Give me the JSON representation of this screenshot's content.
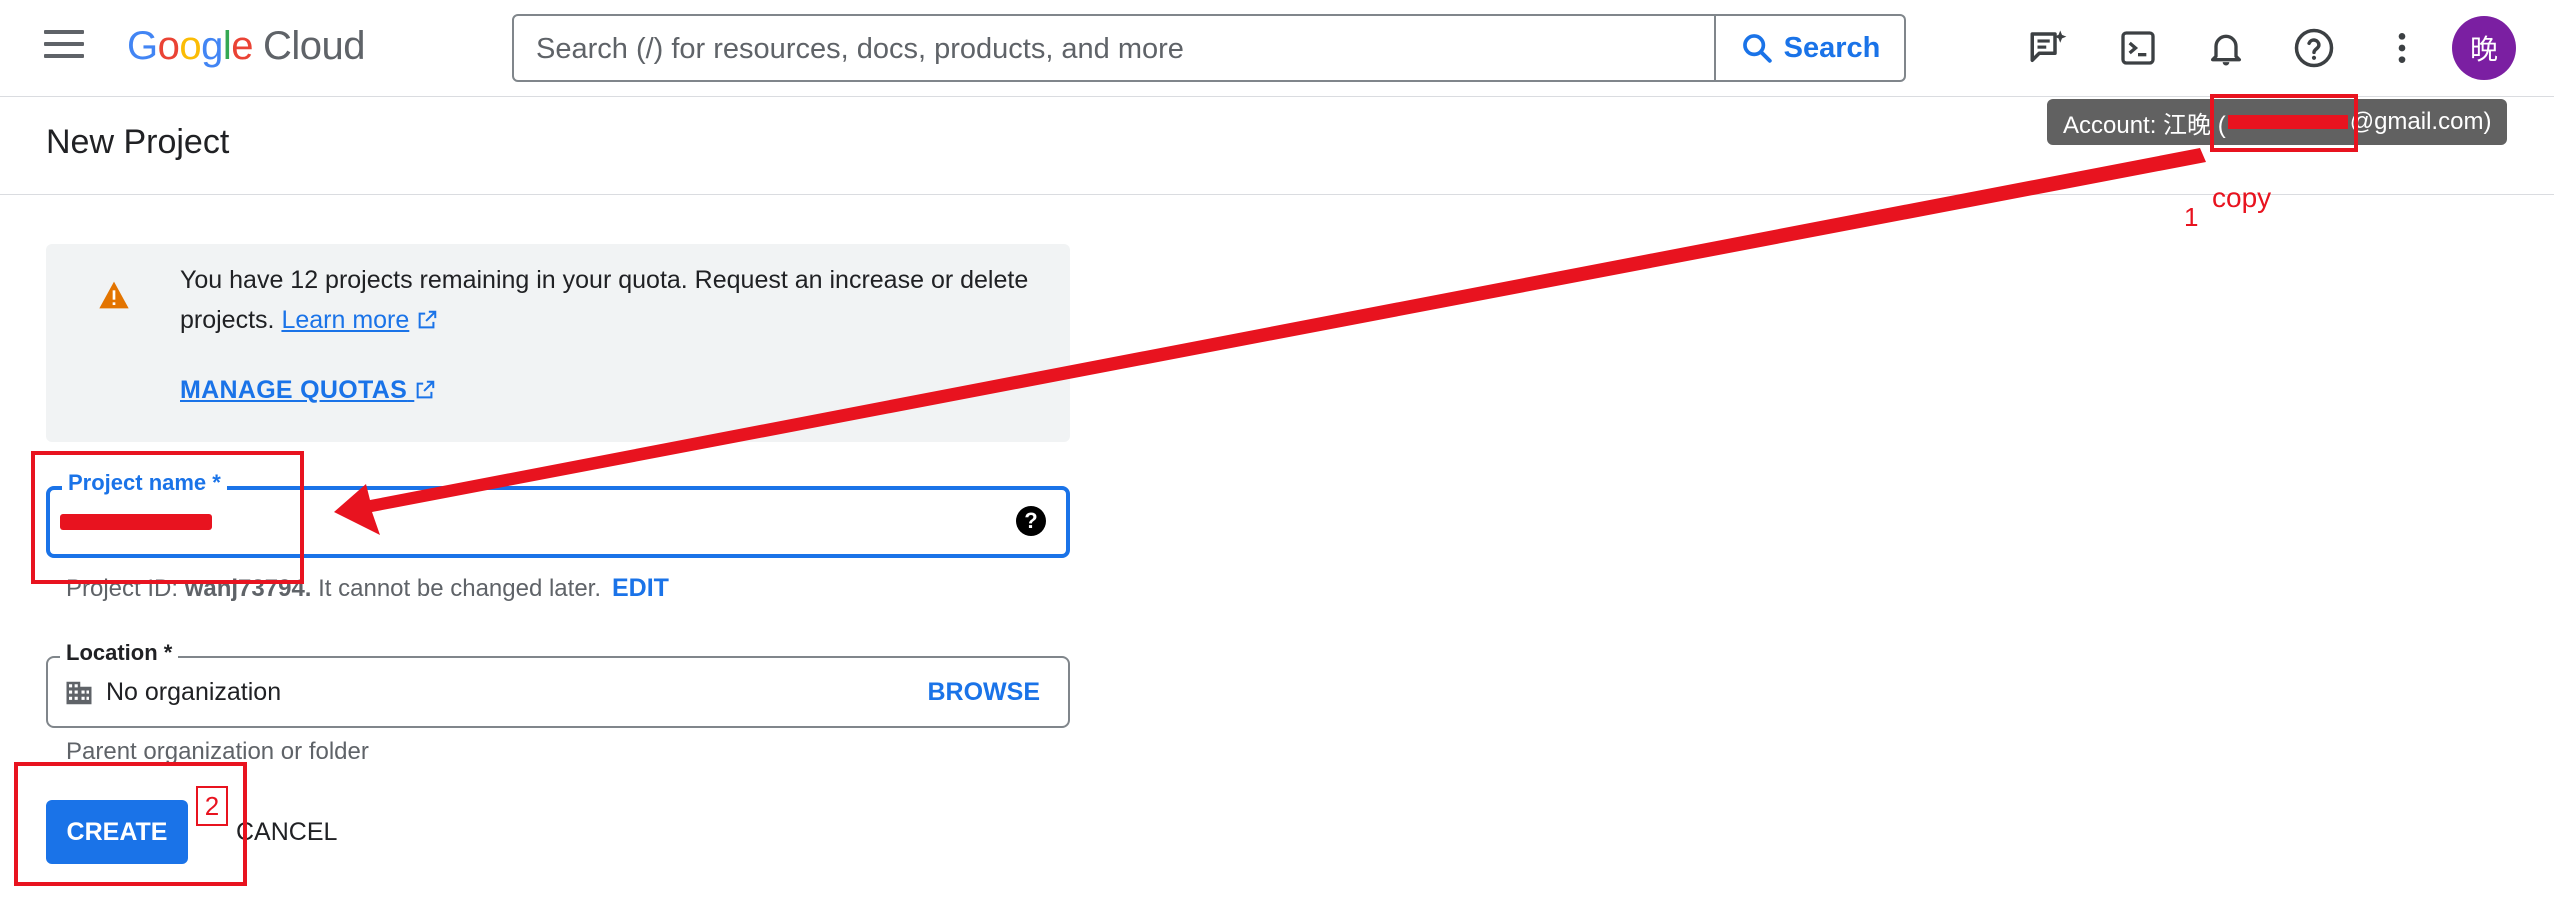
{
  "header": {
    "logo_letters": [
      "G",
      "o",
      "o",
      "g",
      "l",
      "e"
    ],
    "logo_suffix": "Cloud",
    "search": {
      "placeholder": "Search (/) for resources, docs, products, and more",
      "button_label": "Search"
    },
    "icons": [
      "chat-spark-icon",
      "terminal-icon",
      "bell-icon",
      "help-icon",
      "more-vert-icon"
    ],
    "avatar_letter": "晚",
    "account_tooltip_prefix": "Account: 江晚 (",
    "account_tooltip_suffix": "@gmail.com)"
  },
  "page": {
    "title": "New Project"
  },
  "quota": {
    "message": "You have 12 projects remaining in your quota. Request an increase or delete projects.",
    "learn_more": "Learn more",
    "manage_quotas": "MANAGE QUOTAS"
  },
  "form": {
    "project_name": {
      "label": "Project name *",
      "help": "?"
    },
    "project_id": {
      "prefix": "Project ID:",
      "value": "wanj73794.",
      "suffix": "It cannot be changed later.",
      "edit_label": "EDIT"
    },
    "location": {
      "label": "Location *",
      "value": "No organization",
      "browse_label": "BROWSE",
      "hint": "Parent organization or folder"
    },
    "create_label": "CREATE",
    "cancel_label": "CANCEL"
  },
  "annotations": {
    "step1_number": "1",
    "step1_text": "copy",
    "step2_number": "2",
    "color": "#e8131f"
  }
}
